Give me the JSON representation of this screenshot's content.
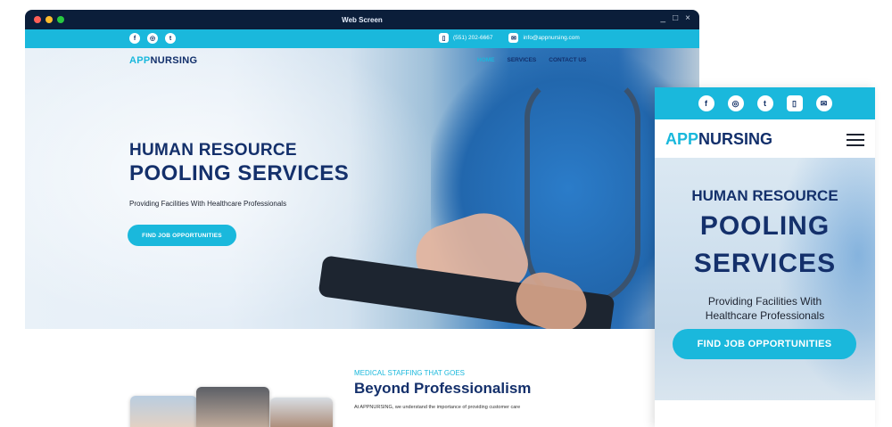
{
  "window": {
    "title": "Web Screen",
    "dot_colors": [
      "#ff5f57",
      "#febc2e",
      "#28c840"
    ],
    "controls": [
      "_",
      "□",
      "×"
    ]
  },
  "topbar": {
    "social_icons": [
      {
        "name": "facebook-icon",
        "glyph": "f"
      },
      {
        "name": "instagram-icon",
        "glyph": "◎"
      },
      {
        "name": "twitter-icon",
        "glyph": "t"
      }
    ],
    "phone_icon": "▯",
    "phone": "(551) 202-6667",
    "email_icon": "✉",
    "email": "info@appnursing.com"
  },
  "brand": {
    "part1": "APP",
    "part2": "NURSING",
    "accent": "#1ab8dc",
    "navy": "#122f6b"
  },
  "nav": {
    "home": "HOME",
    "services": "SERVICES",
    "contact": "CONTACT US"
  },
  "hero": {
    "line1": "HUMAN RESOURCE",
    "line2": "POOLING SERVICES",
    "subtitle": "Providing Facilities With Healthcare Professionals",
    "cta": "FIND JOB OPPORTUNITIES"
  },
  "section": {
    "kicker": "MEDICAL STAFFING THAT GOES",
    "title": "Beyond Professionalism",
    "body": "At APPNURSING, we understand the importance of providing customer care"
  },
  "mobile": {
    "icons": [
      {
        "name": "facebook-icon",
        "glyph": "f"
      },
      {
        "name": "instagram-icon",
        "glyph": "◎"
      },
      {
        "name": "twitter-icon",
        "glyph": "t"
      },
      {
        "name": "phone-icon",
        "glyph": "▯"
      },
      {
        "name": "email-icon",
        "glyph": "✉"
      }
    ],
    "line1": "HUMAN RESOURCE",
    "line2a": "POOLING",
    "line2b": "SERVICES",
    "subtitle": "Providing Facilities With Healthcare Professionals",
    "cta": "FIND JOB OPPORTUNITIES"
  }
}
